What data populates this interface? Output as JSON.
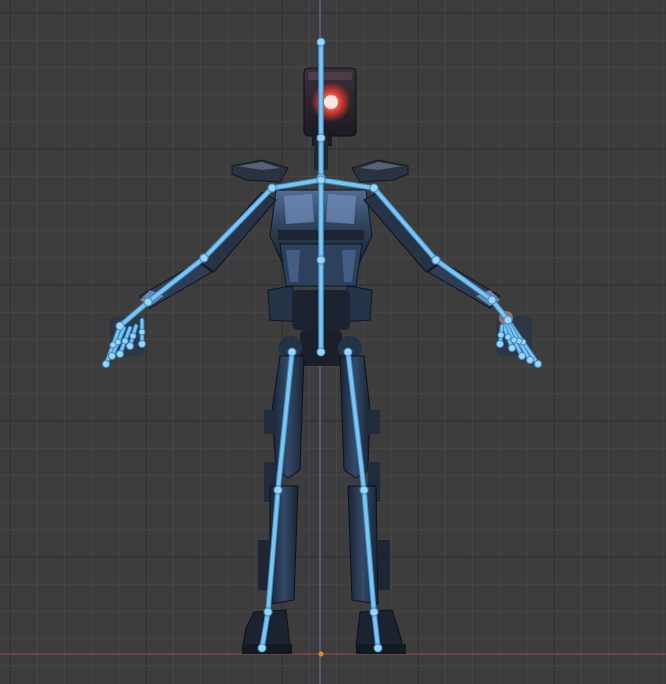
{
  "viewport": {
    "kind": "3d-viewport-front-orthographic",
    "background_color": "#3d3d3d",
    "grid_minor_color": "#474747",
    "grid_major_color": "#2f2f2f",
    "z_axis_color": "#5a7fb0",
    "x_axis_color": "#9a4a4a",
    "origin_marker_color": "#e08a2a"
  },
  "scene_object": {
    "name": "robot-armature",
    "pose": "t-pose-front-view",
    "armor_color": "#2c3d55",
    "armor_highlight_color": "#4d6a95",
    "eye_glow_color": "#ff4a3a",
    "bone_color": "#7ec4ee",
    "bone_outline_color": "#3a8cc8",
    "joint_color": "#9fd4f4"
  }
}
